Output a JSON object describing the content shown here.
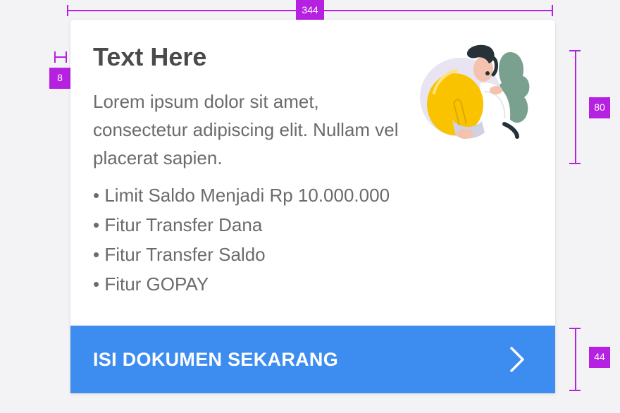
{
  "spec": {
    "width_badge": "344",
    "margin_badge": "8",
    "illustration_badge": "80",
    "cta_badge": "44"
  },
  "card": {
    "title": "Text Here",
    "description": "Lorem ipsum dolor sit amet, consectetur adipiscing elit. Nullam vel placerat sapien.",
    "bullets": [
      "• Limit Saldo Menjadi Rp 10.000.000",
      "• Fitur Transfer Dana",
      "• Fitur Transfer Saldo",
      "• Fitur GOPAY"
    ],
    "cta_label": "ISI DOKUMEN SEKARANG"
  },
  "colors": {
    "accent": "#3d8cf0",
    "spec": "#b620e0",
    "title": "#4a4a4a",
    "body": "#6b6b6b"
  },
  "icons": {
    "illustration": "person-holding-lightbulb-illustration",
    "cta_icon": "chevron-right-icon"
  }
}
